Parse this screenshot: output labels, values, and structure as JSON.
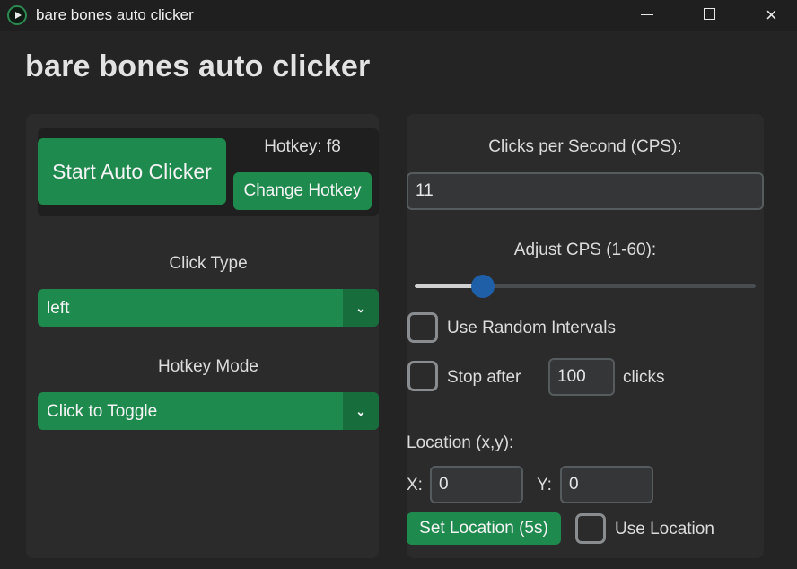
{
  "window": {
    "title": "bare bones auto clicker",
    "close_glyph": "×"
  },
  "heading": "bare bones auto clicker",
  "left": {
    "start_button": "Start Auto Clicker",
    "hotkey_label": "Hotkey: f8",
    "change_hotkey_button": "Change Hotkey",
    "click_type_label": "Click Type",
    "click_type_value": "left",
    "hotkey_mode_label": "Hotkey Mode",
    "hotkey_mode_value": "Click to Toggle"
  },
  "right": {
    "cps_label": "Clicks per Second (CPS):",
    "cps_value": "11",
    "adjust_label": "Adjust CPS (1-60):",
    "slider_value": 11,
    "slider_min": 1,
    "slider_max": 60,
    "random_intervals_label": "Use Random Intervals",
    "random_intervals_checked": false,
    "stop_after_label": "Stop after",
    "stop_after_value": "100",
    "clicks_label": "clicks",
    "stop_after_checked": false,
    "location_label": "Location (x,y):",
    "x_label": "X:",
    "x_value": "0",
    "y_label": "Y:",
    "y_value": "0",
    "set_location_button": "Set Location (5s)",
    "use_location_label": "Use Location",
    "use_location_checked": false
  },
  "colors": {
    "accent_green": "#1f8a4e",
    "slider_knob": "#1f5fa8",
    "background": "#242424",
    "panel": "#2b2b2b"
  },
  "icons": {
    "app": "auto-clicker-app-icon",
    "dropdown": "chevron-down-icon"
  }
}
